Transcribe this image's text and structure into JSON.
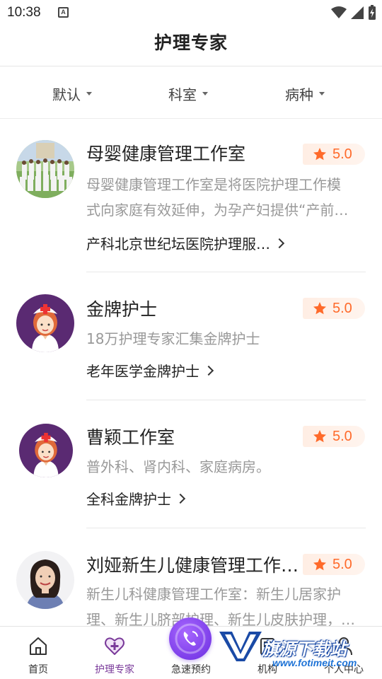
{
  "status": {
    "time": "10:38",
    "notification_letter": "A"
  },
  "header": {
    "title": "护理专家"
  },
  "filters": [
    {
      "label": "默认"
    },
    {
      "label": "科室"
    },
    {
      "label": "病种"
    }
  ],
  "experts": [
    {
      "name": "母婴健康管理工作室",
      "rating": "5.0",
      "desc_lines": [
        "母婴健康管理工作室是将医院护理工作模",
        "式向家庭有效延伸，为孕产妇提供“产前…"
      ],
      "tag": "产科北京世纪坛医院护理服…",
      "avatar": "group-photo"
    },
    {
      "name": "金牌护士",
      "rating": "5.0",
      "desc_lines": [
        "18万护理专家汇集金牌护士"
      ],
      "tag": "老年医学金牌护士",
      "avatar": "nurse-illustration"
    },
    {
      "name": "曹颖工作室",
      "rating": "5.0",
      "desc_lines": [
        "普外科、肾内科、家庭病房。"
      ],
      "tag": "全科金牌护士",
      "avatar": "nurse-illustration"
    },
    {
      "name": "刘娅新生儿健康管理工作…",
      "rating": "5.0",
      "desc_lines": [
        "新生儿科健康管理工作室：新生儿居家护",
        "理、新生儿脐部护理、新生儿皮肤护理，…"
      ],
      "tag": "",
      "avatar": "portrait-photo"
    }
  ],
  "tabbar": {
    "items": [
      {
        "label": "首页",
        "icon": "home-icon",
        "active": false
      },
      {
        "label": "护理专家",
        "icon": "heart-plus-icon",
        "active": true
      },
      {
        "label": "急速预约",
        "icon": "phone-icon",
        "active": false
      },
      {
        "label": "机构",
        "icon": "building-icon",
        "active": false
      },
      {
        "label": "个人中心",
        "icon": "person-icon",
        "active": false
      }
    ]
  },
  "watermark": {
    "text": "旗源下载站",
    "url": "www.fotimeit.com"
  },
  "colors": {
    "accent": "#7a3a9a",
    "rating": "#ff6a2a",
    "fab": "#7b3cf0"
  }
}
